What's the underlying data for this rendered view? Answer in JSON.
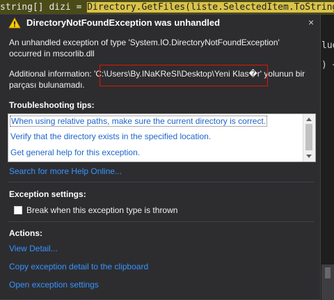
{
  "editor": {
    "code_line_prefix": "string[] dizi = ",
    "code_line_selected": "Directory.GetFiles(liste.SelectedItem.ToString());",
    "side_fragments": [
      "",
      "",
      "lue",
      "",
      ") +",
      "",
      "",
      ""
    ]
  },
  "dialog": {
    "title": "DirectoryNotFoundException was unhandled",
    "close_glyph": "×",
    "message_line1": "An unhandled exception of type 'System.IO.DirectoryNotFoundException'",
    "message_line2": "occurred in mscorlib.dll",
    "additional_label": "Additional information: ",
    "additional_path": "'C:\\Users\\By.INaKReSI\\Desktop\\Yeni Klas�r'",
    "additional_rest": " yolunun bir",
    "additional_line2": "parçası bulunamadı.",
    "tips_heading": "Troubleshooting tips:",
    "tips": [
      "When using relative paths, make sure the current directory is correct.",
      "Verify that the directory exists in the specified location.",
      "Get general help for this exception."
    ],
    "search_link": "Search for more Help Online...",
    "exception_settings_heading": "Exception settings:",
    "break_checkbox_label": "Break when this exception type is thrown",
    "break_checked": false,
    "actions_heading": "Actions:",
    "actions": [
      "View Detail...",
      "Copy exception detail to the clipboard",
      "Open exception settings"
    ],
    "icons": {
      "warning": "warning-icon",
      "close": "close-icon"
    }
  }
}
